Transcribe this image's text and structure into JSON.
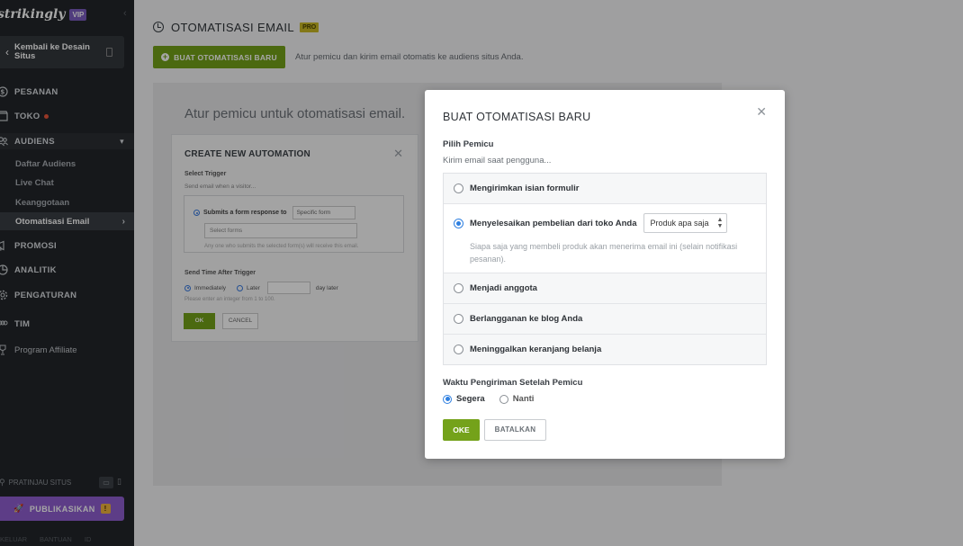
{
  "sidebar": {
    "logo": "strikingly",
    "vip_badge": "VIP",
    "back_label": "Kembali ke Desain Situs",
    "nav": {
      "pesanan": "PESANAN",
      "toko": "TOKO",
      "audiens": "AUDIENS",
      "promosi": "PROMOSI",
      "analitik": "ANALITIK",
      "pengaturan": "PENGATURAN",
      "tim": "TIM"
    },
    "audiens_sub": [
      "Daftar Audiens",
      "Live Chat",
      "Keanggotaan",
      "Otomatisasi Email"
    ],
    "affiliate": "Program Affiliate",
    "preview": "PRATINJAU SITUS",
    "publish": "PUBLIKASIKAN",
    "publish_warning": "!",
    "bottom_links": [
      "KELUAR",
      "BANTUAN",
      "ID"
    ]
  },
  "page": {
    "title": "OTOMATISASI EMAIL",
    "pro_badge": "PRO",
    "create_button": "BUAT OTOMATISASI BARU",
    "header_desc": "Atur pemicu dan kirim email otomatis ke audiens situs Anda.",
    "card_heading": "Atur pemicu untuk otomatisasi email."
  },
  "mini_dialog": {
    "title": "CREATE NEW AUTOMATION",
    "select_trigger": "Select Trigger",
    "send_when": "Send email when a visitor...",
    "option_form": "Submits a form response to",
    "specific_form": "Specific form",
    "select_form_placeholder": "Select forms",
    "hint": "Any one who submits the selected form(s) will receive this email.",
    "send_time": "Send Time After Trigger",
    "immediately": "Immediately",
    "later": "Later",
    "day_later": "day later",
    "enter_integer": "Please enter an integer from 1 to 100.",
    "ok": "OK",
    "cancel": "CANCEL"
  },
  "modal": {
    "title": "BUAT OTOMATISASI BARU",
    "trigger_label": "Pilih Pemicu",
    "trigger_sub": "Kirim email saat pengguna...",
    "options": [
      "Mengirimkan isian formulir",
      "Menyelesaikan pembelian dari toko Anda",
      "Menjadi anggota",
      "Berlangganan ke blog Anda",
      "Meninggalkan keranjang belanja"
    ],
    "product_select": "Produk apa saja",
    "selected_desc": "Siapa saja yang membeli produk akan menerima email ini (selain notifikasi pesanan).",
    "send_time_label": "Waktu Pengiriman Setelah Pemicu",
    "time_now": "Segera",
    "time_later": "Nanti",
    "ok": "OKE",
    "cancel": "BATALKAN"
  },
  "colors": {
    "sidebar_bg": "#23262a",
    "accent_green": "#74a21a",
    "publish_purple": "#8f5fd0",
    "radio_blue": "#2e7fe0"
  }
}
